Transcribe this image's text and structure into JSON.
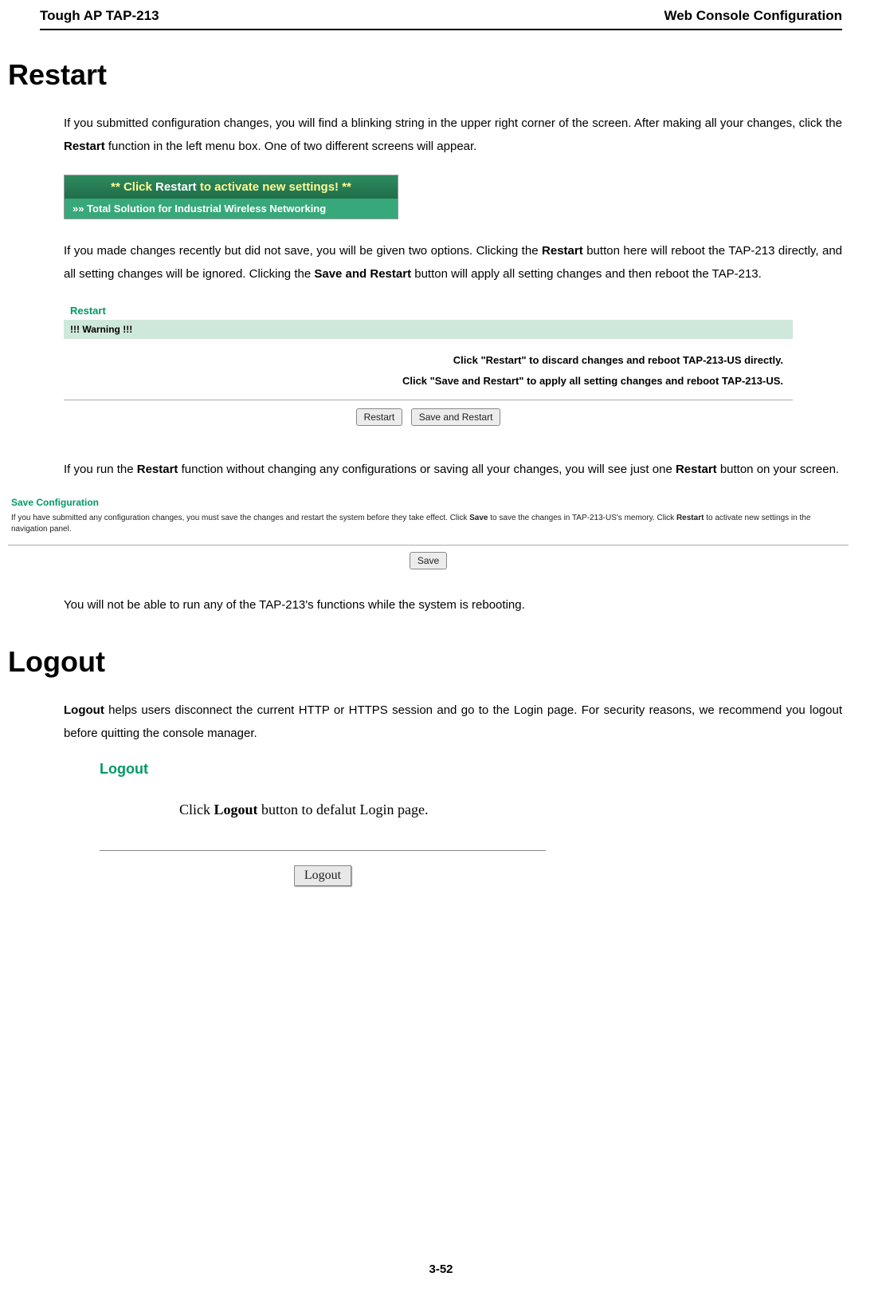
{
  "header": {
    "left": "Tough AP TAP-213",
    "right": "Web Console Configuration"
  },
  "restart": {
    "title": "Restart",
    "p1a": "If you submitted configuration changes, you will find a blinking string in the upper right corner of the screen. After making all your changes, click the ",
    "p1b": "Restart",
    "p1c": " function in the left menu box. One of two different screens will appear.",
    "banner": {
      "top_a": "** Click ",
      "top_b": "Restart",
      "top_c": " to activate new settings! **",
      "bottom": "»» Total Solution for Industrial Wireless Networking"
    },
    "p2a": "If you made changes recently but did not save, you will be given two options. Clicking the ",
    "p2b": "Restart",
    "p2c": " button here will reboot the TAP-213 directly, and all setting changes will be ignored. Clicking the ",
    "p2d": "Save and Restart",
    "p2e": " button will apply all setting changes and then reboot the TAP-213.",
    "box": {
      "title": "Restart",
      "warning": "!!! Warning !!!",
      "msg1": "Click \"Restart\" to discard changes and reboot TAP-213-US directly.",
      "msg2": "Click \"Save and Restart\" to apply all setting changes and reboot TAP-213-US.",
      "btn_restart": "Restart",
      "btn_save_restart": "Save and Restart"
    },
    "p3a": "If you run the ",
    "p3b": "Restart",
    "p3c": " function without changing any configurations or saving all your changes, you will see just one ",
    "p3d": "Restart",
    "p3e": " button on your screen.",
    "savebox": {
      "title": "Save Configuration",
      "desc_a": "If you have submitted any configuration changes, you must save the changes and restart the system before they take effect. Click ",
      "desc_b": "Save",
      "desc_c": " to save the changes in TAP-213-US's memory. Click ",
      "desc_d": "Restart",
      "desc_e": " to activate new settings in the navigation panel.",
      "btn_save": "Save"
    },
    "p4": "You will not be able to run any of the TAP-213's functions while the system is rebooting."
  },
  "logout": {
    "title": "Logout",
    "p1a": "Logout",
    "p1b": " helps users disconnect the current HTTP or HTTPS session and go to the Login page. For security reasons, we recommend you logout before quitting the console manager.",
    "box": {
      "title": "Logout",
      "msg_a": "Click ",
      "msg_b": "Logout",
      "msg_c": " button to defalut Login page.",
      "btn": "Logout"
    }
  },
  "page_num": "3-52"
}
